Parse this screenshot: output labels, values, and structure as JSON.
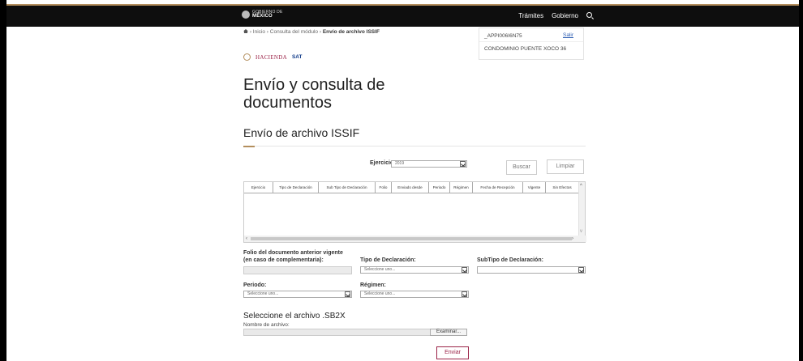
{
  "header": {
    "logo_top": "GOBIERNO DE",
    "logo_main": "MÉXICO",
    "nav": [
      "Trámites",
      "Gobierno"
    ]
  },
  "breadcrumb": {
    "inicio": "Inicio",
    "modulo": "Consulta del módulo",
    "current": "Envío de archivo ISSIF",
    "sep": "›"
  },
  "user": {
    "rfc": "_APPI006I6N75",
    "salir": "Salir",
    "entity": "CONDOMINIO PUENTE XOCO 36"
  },
  "brand": {
    "hacienda": "HACIENDA",
    "sat": "SAT"
  },
  "page": {
    "title": "Envío y consulta de documentos",
    "subtitle": "Envío de archivo ISSIF"
  },
  "filter": {
    "ejercicio_label": "Ejercicio:",
    "ejercicio_value": "2019",
    "buscar": "Buscar",
    "limpiar": "Limpiar"
  },
  "table": {
    "columns": [
      "Ejercicio",
      "Tipo de Declaración",
      "Sub Tipo de Declaración",
      "Folio",
      "Enviado desde",
      "Periodo",
      "Régimen",
      "Fecha de Recepción",
      "Vigente",
      "Sin Efectos"
    ],
    "rows": []
  },
  "form": {
    "folio_label_1": "Folio del documento anterior vigente",
    "folio_label_2": "(en caso de complementaria):",
    "tipo_label": "Tipo de Declaración:",
    "tipo_value": "Seleccione uno...",
    "subtipo_label": "SubTipo de Declaración:",
    "subtipo_value": "",
    "periodo_label": "Periodo:",
    "periodo_value": "Seleccione uno...",
    "regimen_label": "Régimen:",
    "regimen_value": "Seleccione uno..."
  },
  "upload": {
    "heading": "Seleccione el archivo .SB2X",
    "file_label": "Nombre de archivo:",
    "examinar": "Examinar...",
    "enviar": "Enviar"
  }
}
